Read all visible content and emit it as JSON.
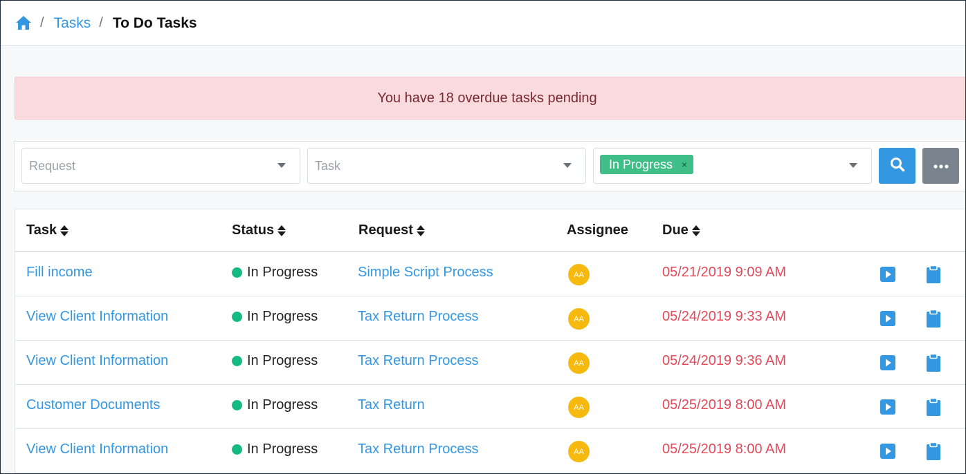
{
  "breadcrumb": {
    "home_icon": "home-icon",
    "items": [
      "Tasks",
      "To Do Tasks"
    ],
    "separator": "/"
  },
  "alert": {
    "message": "You have 18 overdue tasks pending",
    "color": "#f9dadd"
  },
  "filters": {
    "request_placeholder": "Request",
    "task_placeholder": "Task",
    "status_tag": "In Progress",
    "status_tag_remove": "×",
    "search_icon": "search-icon",
    "more_icon": "ellipsis-icon"
  },
  "table": {
    "columns": [
      "Task",
      "Status",
      "Request",
      "Assignee",
      "Due"
    ],
    "rows": [
      {
        "task": "Fill income",
        "status": "In Progress",
        "request": "Simple Script Process",
        "assignee": "AA",
        "due": "05/21/2019 9:09 AM"
      },
      {
        "task": "View Client Information",
        "status": "In Progress",
        "request": "Tax Return Process",
        "assignee": "AA",
        "due": "05/24/2019 9:33 AM"
      },
      {
        "task": "View Client Information",
        "status": "In Progress",
        "request": "Tax Return Process",
        "assignee": "AA",
        "due": "05/24/2019 9:36 AM"
      },
      {
        "task": "Customer Documents",
        "status": "In Progress",
        "request": "Tax Return",
        "assignee": "AA",
        "due": "05/25/2019 8:00 AM"
      },
      {
        "task": "View Client Information",
        "status": "In Progress",
        "request": "Tax Return Process",
        "assignee": "AA",
        "due": "05/25/2019 8:00 AM"
      }
    ]
  },
  "colors": {
    "accent": "#3397e2",
    "status_green": "#15b981",
    "overdue_red": "#e04a5a",
    "avatar_yellow": "#f5b90f"
  }
}
